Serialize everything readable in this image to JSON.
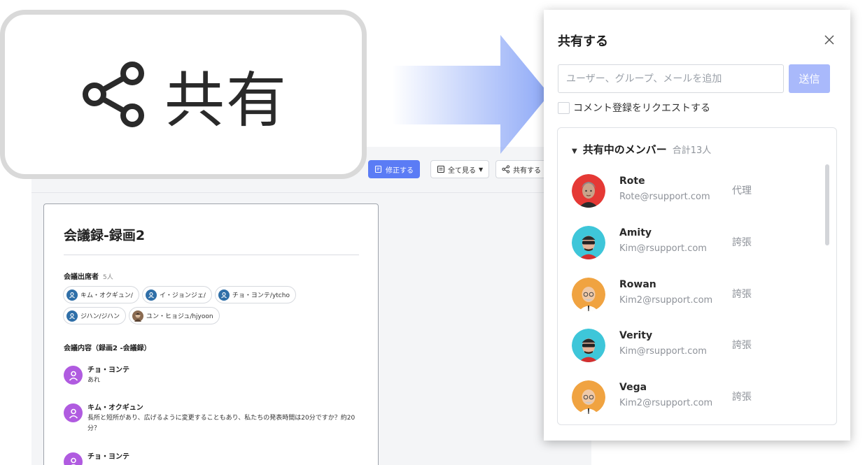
{
  "toolbar": {
    "edit_label": "修正する",
    "view_all_label": "全て見る",
    "share_label": "共有する"
  },
  "document": {
    "title": "会議録-録画2",
    "attendees_label": "会議出席者",
    "attendees_count": "5人",
    "attendees": [
      {
        "name": "キム・オクギュン/",
        "avatar": "user-icon"
      },
      {
        "name": "イ・ジョンジェ/",
        "avatar": "user-icon"
      },
      {
        "name": "チョ・ヨンテ/ytcho",
        "avatar": "user-icon"
      },
      {
        "name": "ジハン/ジハン",
        "avatar": "user-icon"
      },
      {
        "name": "ユン・ヒョジュ/hjyoon",
        "avatar": "photo"
      }
    ],
    "content_label": "会議内容（録画2 -会議録）",
    "messages": [
      {
        "speaker": "チョ・ヨンテ",
        "text": "あれ"
      },
      {
        "speaker": "キム・オクギュン",
        "text": "長所と短所があり、広げるように変更することもあり、私たちの発表時間は20分ですか？約20分？"
      },
      {
        "speaker": "チョ・ヨンテ",
        "text": ""
      }
    ]
  },
  "callout": {
    "label": "共有",
    "icon": "share-icon"
  },
  "share_panel": {
    "title": "共有する",
    "input_placeholder": "ユーザー、グループ、メールを追加",
    "send_label": "送信",
    "request_comment_label": "コメント登録をリクエストする",
    "members_title": "共有中のメンバー",
    "members_total": "合計13人",
    "members": [
      {
        "name": "Rote",
        "email": "Rote@rsupport.com",
        "role": "代理",
        "avatar_bg": "#e53935",
        "skin": "#c9a38a",
        "style": "hair"
      },
      {
        "name": "Amity",
        "email": "Kim@rsupport.com",
        "role": "誇張",
        "avatar_bg": "#3ec6d9",
        "skin": "#e4b49a",
        "style": "glasses"
      },
      {
        "name": "Rowan",
        "email": "Kim2@rsupport.com",
        "role": "誇張",
        "avatar_bg": "#f0a341",
        "skin": "#efc9a8",
        "style": "bald"
      },
      {
        "name": "Verity",
        "email": "Kim@rsupport.com",
        "role": "誇張",
        "avatar_bg": "#3ec6d9",
        "skin": "#e4b49a",
        "style": "glasses"
      },
      {
        "name": "Vega",
        "email": "Kim2@rsupport.com",
        "role": "誇張",
        "avatar_bg": "#f0a341",
        "skin": "#efc9a8",
        "style": "bald"
      }
    ]
  },
  "colors": {
    "accent": "#5b7cf5",
    "send_button": "#a9b9fb",
    "arrow": "#8ea9f7"
  }
}
